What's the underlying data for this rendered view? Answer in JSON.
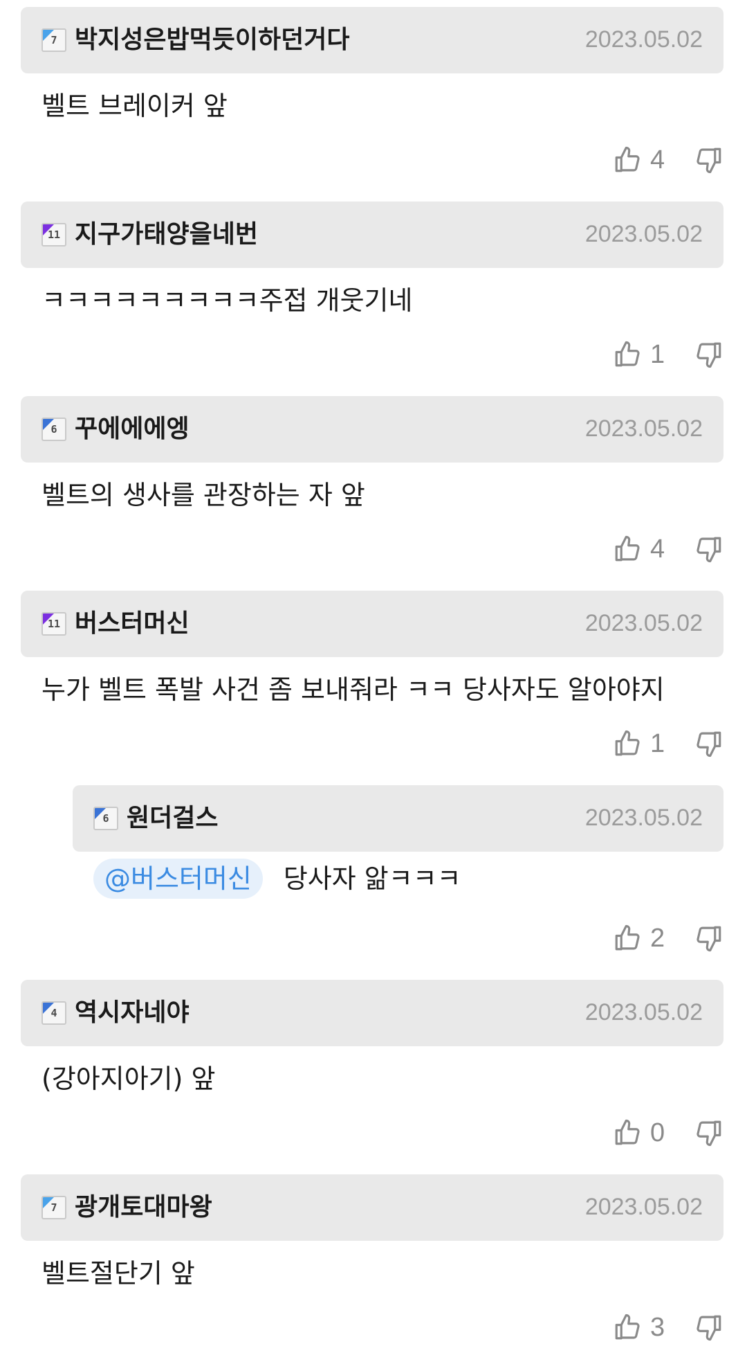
{
  "comments": [
    {
      "level": "7",
      "badge_color": "#4aa3ea",
      "nickname": "박지성은밥먹듯이하던거다",
      "date": "2023.05.02",
      "text": "벨트 브레이커 앞",
      "likes": "4"
    },
    {
      "level": "11",
      "badge_color": "#7b2fe0",
      "nickname": "지구가태양을네번",
      "date": "2023.05.02",
      "text": "ㅋㅋㅋㅋㅋㅋㅋㅋㅋ주접 개웃기네",
      "likes": "1"
    },
    {
      "level": "6",
      "badge_color": "#3a73d6",
      "nickname": "꾸에에에엥",
      "date": "2023.05.02",
      "text": "벨트의 생사를 관장하는 자 앞",
      "likes": "4"
    },
    {
      "level": "11",
      "badge_color": "#7b2fe0",
      "nickname": "버스터머신",
      "date": "2023.05.02",
      "text": "누가 벨트 폭발 사건 좀 보내줘라 ㅋㅋ 당사자도 알아야지",
      "likes": "1"
    },
    {
      "level": "6",
      "badge_color": "#3a73d6",
      "nickname": "원더걸스",
      "date": "2023.05.02",
      "mention": "@버스터머신",
      "text": "당사자 앎ㅋㅋㅋ",
      "likes": "2"
    },
    {
      "level": "4",
      "badge_color": "#3a73d6",
      "nickname": "역시자네야",
      "date": "2023.05.02",
      "text": "(강아지아기) 앞",
      "likes": "0"
    },
    {
      "level": "7",
      "badge_color": "#4aa3ea",
      "nickname": "광개토대마왕",
      "date": "2023.05.02",
      "text": "벨트절단기 앞",
      "likes": "3"
    }
  ]
}
